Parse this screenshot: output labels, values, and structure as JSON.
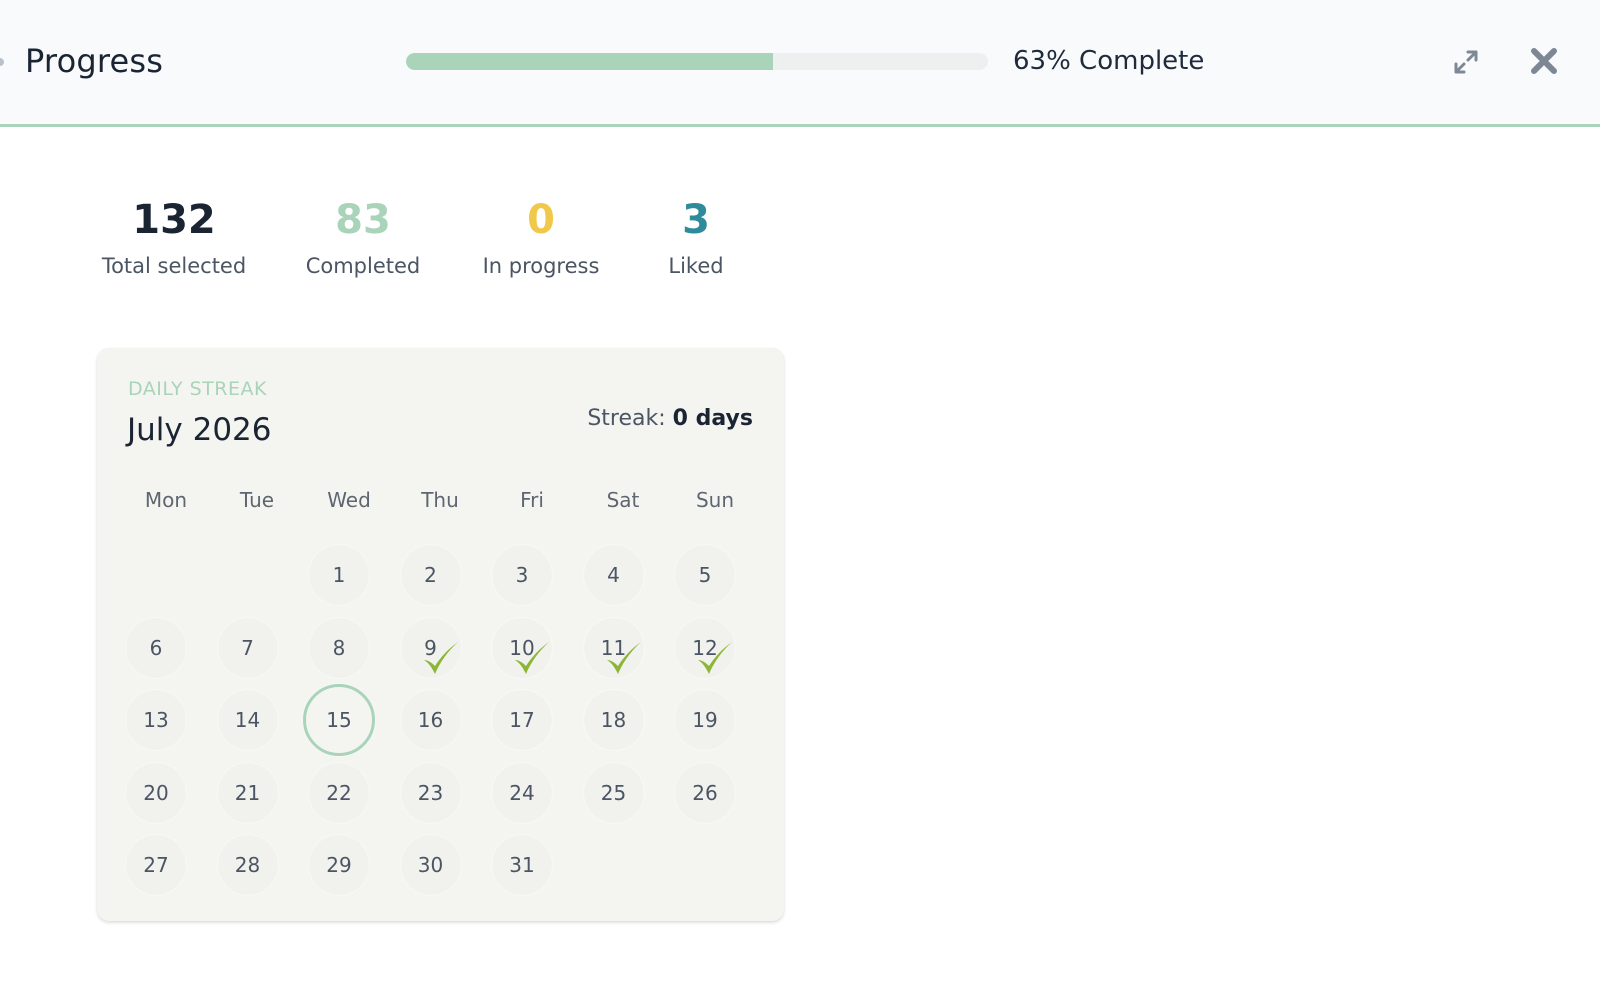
{
  "header": {
    "title": "Progress",
    "progress_percent": 63,
    "progress_label": "63% Complete",
    "accent_color": "#a9d4b9",
    "expand_icon": "expand-icon",
    "close_icon": "close-icon"
  },
  "stats": [
    {
      "value": "132",
      "label": "Total selected",
      "color": "#1a2433"
    },
    {
      "value": "83",
      "label": "Completed",
      "color": "#a9d4b9"
    },
    {
      "value": "0",
      "label": "In progress",
      "color": "#f0c94a"
    },
    {
      "value": "3",
      "label": "Liked",
      "color": "#2e8b99"
    }
  ],
  "calendar": {
    "kicker": "DAILY STREAK",
    "month": "July 2026",
    "streak_label": "Streak:",
    "streak_value": "0 days",
    "weekdays": [
      "Mon",
      "Tue",
      "Wed",
      "Thu",
      "Fri",
      "Sat",
      "Sun"
    ],
    "first_weekday_index": 2,
    "days_in_month": 31,
    "today": 15,
    "checked_days": [
      9,
      10,
      11,
      12
    ],
    "check_color": "#8db536"
  }
}
